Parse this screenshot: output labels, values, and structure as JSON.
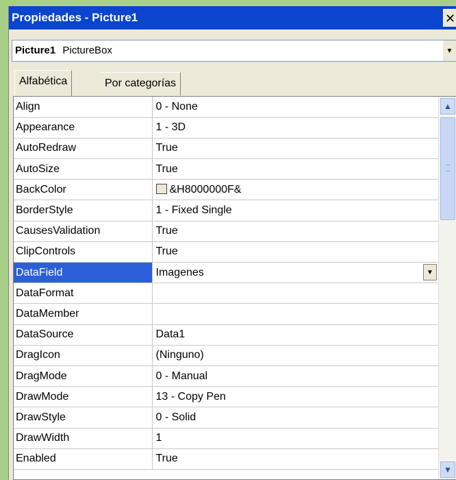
{
  "window": {
    "title": "Propiedades - Picture1",
    "close_glyph": "✕"
  },
  "object_combo": {
    "name": "Picture1",
    "type": "PictureBox",
    "drop_glyph": "▼"
  },
  "tabs": [
    {
      "label": "Alfabética",
      "active": true
    },
    {
      "label": "Por categorías",
      "active": false
    }
  ],
  "properties": [
    {
      "name": "Align",
      "value": "0 - None"
    },
    {
      "name": "Appearance",
      "value": "1 - 3D"
    },
    {
      "name": "AutoRedraw",
      "value": "True"
    },
    {
      "name": "AutoSize",
      "value": "True"
    },
    {
      "name": "BackColor",
      "value": "&H8000000F&",
      "swatch": "#ece9d8"
    },
    {
      "name": "BorderStyle",
      "value": "1 - Fixed Single"
    },
    {
      "name": "CausesValidation",
      "value": "True"
    },
    {
      "name": "ClipControls",
      "value": "True"
    },
    {
      "name": "DataField",
      "value": "Imagenes",
      "selected": true,
      "dropdown": true
    },
    {
      "name": "DataFormat",
      "value": ""
    },
    {
      "name": "DataMember",
      "value": ""
    },
    {
      "name": "DataSource",
      "value": "Data1"
    },
    {
      "name": "DragIcon",
      "value": "(Ninguno)"
    },
    {
      "name": "DragMode",
      "value": "0 - Manual"
    },
    {
      "name": "DrawMode",
      "value": "13 - Copy Pen"
    },
    {
      "name": "DrawStyle",
      "value": "0 - Solid"
    },
    {
      "name": "DrawWidth",
      "value": "1"
    },
    {
      "name": "Enabled",
      "value": "True"
    }
  ],
  "scrollbar": {
    "up_glyph": "▲",
    "down_glyph": "▼",
    "position": 0.0
  },
  "colors": {
    "title_bar": "#0a44cf",
    "selection": "#2c5ed8",
    "background": "#a8cf88"
  }
}
